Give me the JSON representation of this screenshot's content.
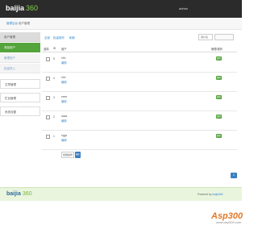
{
  "header": {
    "brand": "baijia",
    "brand_num": "360",
    "subtitle": "",
    "user_menu": "admin",
    "site_link": ""
  },
  "breadcrumb": {
    "home": "管理后台",
    "sep": "/",
    "current": "用户管理"
  },
  "sidebar": {
    "items": [
      {
        "label": "用户管理"
      },
      {
        "label": "添加用户"
      },
      {
        "label": "管理用户"
      },
      {
        "label": "批量导入"
      },
      {
        "label": "文章管理"
      },
      {
        "label": "栏目管理"
      },
      {
        "label": "系统设置"
      }
    ]
  },
  "toolbar": {
    "all": "全部",
    "batch": "批量操作",
    "refresh": "刷新",
    "search_placeholder": "用户名"
  },
  "table": {
    "headers": [
      "选择",
      "ID",
      "用户",
      "",
      "管理/操作"
    ],
    "rows": [
      {
        "id": "5",
        "name": "hhh",
        "edit": "编辑",
        "op": "删除"
      },
      {
        "id": "4",
        "name": "hhh",
        "edit": "编辑",
        "op": "删除"
      },
      {
        "id": "3",
        "name": "eeee",
        "edit": "编辑",
        "op": "删除"
      },
      {
        "id": "2",
        "name": "aaaa",
        "edit": "编辑",
        "op": "删除"
      },
      {
        "id": "1",
        "name": "eggs",
        "edit": "编辑",
        "op": "删除"
      }
    ]
  },
  "batch": {
    "select": "批量操作",
    "button": "确定"
  },
  "pagination": {
    "current": "1"
  },
  "footer": {
    "brand": "baijia",
    "brand_num": "360",
    "powered_prefix": "Powered by",
    "powered_link": "baijia360"
  },
  "watermark": {
    "main": "Asp300",
    "sub": "www.asp300.com"
  },
  "colors": {
    "accent_green": "#54a43c",
    "link_blue": "#3a8bd0",
    "topbar": "#2b2b2b"
  }
}
